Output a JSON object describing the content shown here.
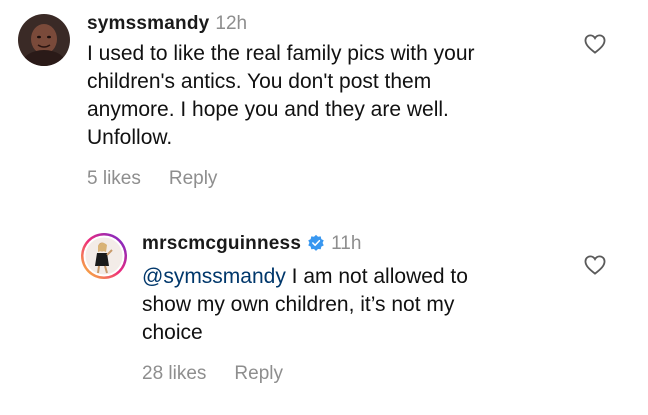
{
  "comments": [
    {
      "username": "symssmandy",
      "time": "12h",
      "verified": false,
      "mention": "",
      "text_lines": [
        "I used to like the real family pics with your",
        "children's antics. You don't post them",
        "anymore. I hope you and they are well.",
        "Unfollow."
      ],
      "likes": "5 likes",
      "reply_label": "Reply",
      "avatar_icon": "profile-photo-icon",
      "like_icon": "heart-outline-icon"
    },
    {
      "username": "mrscmcguinness",
      "time": "11h",
      "verified": true,
      "mention": "@symssmandy",
      "text_lines": [
        " I am not allowed to",
        "show my own children, it’s not my",
        "choice"
      ],
      "likes": "28 likes",
      "reply_label": "Reply",
      "avatar_icon": "story-ring-profile-photo-icon",
      "like_icon": "heart-outline-icon"
    }
  ],
  "colors": {
    "verified_blue": "#3897f0",
    "mention_blue": "#00376b",
    "muted_gray": "#8e8e8e",
    "story_ring_start": "#f9ce34",
    "story_ring_mid": "#ee2a7b",
    "story_ring_end": "#6228d7"
  }
}
